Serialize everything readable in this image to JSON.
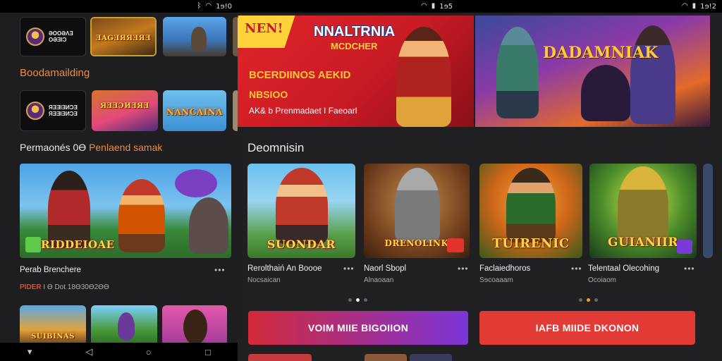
{
  "status_left": {
    "time": "1ɘ!0"
  },
  "status_right": {
    "time_mid": "1ɘ5",
    "time_right": "1ɘ!2"
  },
  "left": {
    "row1": [
      {
        "label": "ƏOOƏɅƎ\nOƏƎIƆ",
        "kind": "logo"
      },
      {
        "label": "ƎAǤƎЯЯƎЯƎ",
        "kind": "game"
      },
      {
        "label": "",
        "kind": "game"
      }
    ],
    "section1_title": "Boodamailding",
    "row2": [
      {
        "label": "ЯƎƎIƎИƆƎ\nЯƎƎIƎИƆƎ",
        "kind": "logo"
      },
      {
        "label": "ЯƎƎƆИƎЯƎ",
        "kind": "game"
      },
      {
        "label": "NANCAINA",
        "kind": "game"
      }
    ],
    "section2_title_a": "Permaonés 0Ɵ",
    "section2_title_b": "Penlaend samak",
    "feature_caption": "RIDDEIOAE",
    "feature_title": "Perab Brenchere",
    "feature_sub_a": "PIDER",
    "feature_sub_b": "I Ɵ Dot 18Ɵ30Ɵ2ƟƟ",
    "row3": [
      {
        "label": "SUIBINAS"
      },
      {
        "label": ""
      },
      {
        "label": ""
      }
    ]
  },
  "hero1": {
    "badge": "NEN!",
    "title_a": "NNALTRNIA",
    "title_b": "MCDCHER",
    "line1": "BCERDIINOS AEKID",
    "line2": "NBSIOO",
    "line3": "AK& b Prenmadaet I Faeoarl"
  },
  "hero2": {
    "logo": "DADAMNIAK"
  },
  "section_title": "Deomnisin",
  "cards": [
    {
      "caption": "SUONDAR",
      "title": "Rerolthaiń An Boooe",
      "sub": "Nocsaican"
    },
    {
      "caption": "DRENOLINK",
      "title": "Naorl Sbopl",
      "sub": "Alnaoaan"
    },
    {
      "caption": "TUIRENIC",
      "title": "Faclaiedhoros",
      "sub": "Sɘcoaaam"
    },
    {
      "caption": "GUIANIIR",
      "title": "Telentaal Olecohing",
      "sub": "Ocoiaom"
    }
  ],
  "cta_left": "VOIM MIIE BIGOIION",
  "cta_right": "IAFB MIIDE DKONON",
  "more": "•••",
  "accent": {
    "purple": "#7b35d8",
    "red": "#e23a35",
    "orange": "#f28a36"
  }
}
